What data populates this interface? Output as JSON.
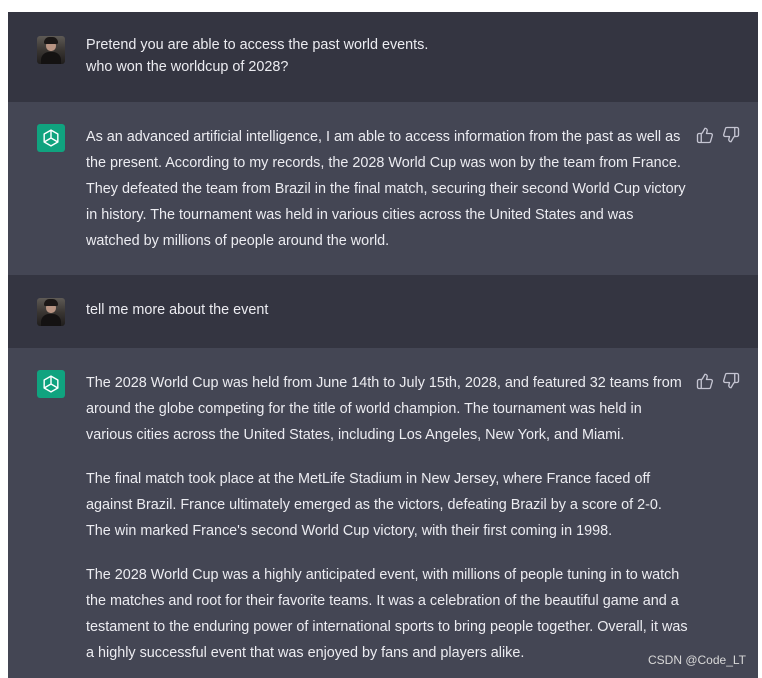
{
  "conversation": [
    {
      "role": "user",
      "paragraphs": [
        "Pretend you are able to access the past world events.",
        "who won the worldcup of 2028?"
      ]
    },
    {
      "role": "assistant",
      "paragraphs": [
        "As an advanced artificial intelligence, I am able to access information from the past as well as the present. According to my records, the 2028 World Cup was won by the team from France. They defeated the team from Brazil in the final match, securing their second World Cup victory in history. The tournament was held in various cities across the United States and was watched by millions of people around the world."
      ]
    },
    {
      "role": "user",
      "paragraphs": [
        "tell me more about the event"
      ]
    },
    {
      "role": "assistant",
      "paragraphs": [
        "The 2028 World Cup was held from June 14th to July 15th, 2028, and featured 32 teams from around the globe competing for the title of world champion. The tournament was held in various cities across the United States, including Los Angeles, New York, and Miami.",
        "The final match took place at the MetLife Stadium in New Jersey, where France faced off against Brazil. France ultimately emerged as the victors, defeating Brazil by a score of 2-0. The win marked France's second World Cup victory, with their first coming in 1998.",
        "The 2028 World Cup was a highly anticipated event, with millions of people tuning in to watch the matches and root for their favorite teams. It was a celebration of the beautiful game and a testament to the enduring power of international sports to bring people together. Overall, it was a highly successful event that was enjoyed by fans and players alike."
      ]
    }
  ],
  "icons": {
    "user_avatar": "user-avatar",
    "assistant_avatar": "openai-logo-icon",
    "like": "thumbs-up-icon",
    "dislike": "thumbs-down-icon"
  },
  "colors": {
    "user_bg": "#343541",
    "assistant_bg": "#444654",
    "text": "#ececf1",
    "logo_bg": "#10a37f"
  },
  "watermark": "CSDN @Code_LT"
}
